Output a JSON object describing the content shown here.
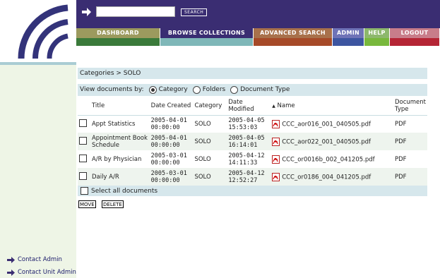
{
  "search": {
    "value": "",
    "button_label": "SEARCH"
  },
  "nav": {
    "items": [
      {
        "label": "DASHBOARD",
        "color": "#9c9a5e",
        "strip": "#3a7a3a",
        "width": 119
      },
      {
        "label": "BROWSE COLLECTIONS",
        "color": "#3a2d72",
        "strip": "#7fb7b8",
        "width": 132
      },
      {
        "label": "ADVANCED SEARCH",
        "color": "#a8714b",
        "strip": "#a64a28",
        "width": 112
      },
      {
        "label": "ADMIN",
        "color": "#6f73b7",
        "strip": "#3d55a0",
        "width": 45
      },
      {
        "label": "HELP",
        "color": "#8db86d",
        "strip": "#78b83c",
        "width": 36
      },
      {
        "label": "LOGOUT",
        "color": "#c87d8a",
        "strip": "#b52535",
        "width": 71
      }
    ]
  },
  "breadcrumb": "Categories > SOLO",
  "view_by": {
    "label": "View documents by:",
    "options": [
      {
        "label": "Category",
        "selected": true
      },
      {
        "label": "Folders",
        "selected": false
      },
      {
        "label": "Document Type",
        "selected": false
      }
    ]
  },
  "table": {
    "headers": {
      "title": "Title",
      "date_created": "Date Created",
      "category": "Category",
      "date_modified": "Date Modified",
      "name": "Name",
      "doc_type": "Document Type"
    },
    "sort_indicator": "▲",
    "rows": [
      {
        "title": "Appt Statistics",
        "created_date": "2005-04-01",
        "created_time": "00:00:00",
        "category": "SOLO",
        "modified_date": "2005-04-05",
        "modified_time": "15:53:03",
        "name": "CCC_aor016_001_040505.pdf",
        "type": "PDF"
      },
      {
        "title": "Appointment Book Schedule",
        "created_date": "2005-04-01",
        "created_time": "00:00:00",
        "category": "SOLO",
        "modified_date": "2005-04-05",
        "modified_time": "16:14:01",
        "name": "CCC_aor022_001_040505.pdf",
        "type": "PDF"
      },
      {
        "title": "A/R by Physician",
        "created_date": "2005-03-01",
        "created_time": "00:00:00",
        "category": "SOLO",
        "modified_date": "2005-04-12",
        "modified_time": "14:11:33",
        "name": "CCC_or0016b_002_041205.pdf",
        "type": "PDF"
      },
      {
        "title": "Daily A/R",
        "created_date": "2005-03-01",
        "created_time": "00:00:00",
        "category": "SOLO",
        "modified_date": "2005-04-12",
        "modified_time": "12:52:27",
        "name": "CCC_or0186_004_041205.pdf",
        "type": "PDF"
      }
    ]
  },
  "select_all_label": "Select all documents",
  "actions": {
    "move": "MOVE",
    "delete": "DELETE"
  },
  "sidebar_links": [
    "Contact Admin",
    "Contact Unit Admin"
  ],
  "colors": {
    "header": "#3a2d72",
    "panel": "#d6e7ec",
    "sidebar": "#eef5e6"
  }
}
